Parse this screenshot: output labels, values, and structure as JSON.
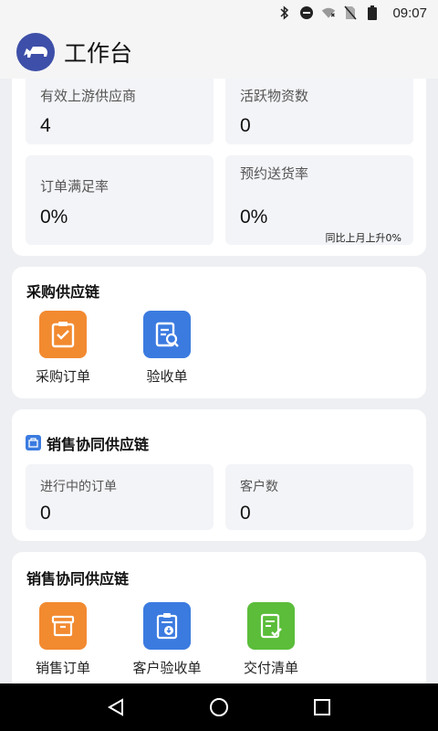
{
  "status_bar": {
    "time": "09:07",
    "icons": [
      "bluetooth-icon",
      "do-not-disturb-icon",
      "wifi-icon",
      "no-sim-icon",
      "battery-icon"
    ]
  },
  "app_bar": {
    "title": "工作台",
    "logo_icon": "rhino-logo-icon"
  },
  "summary": {
    "stats": [
      {
        "label": "有效上游供应商",
        "value": "4"
      },
      {
        "label": "活跃物资数",
        "value": "0"
      },
      {
        "label": "订单满足率",
        "value": "0%"
      },
      {
        "label": "预约送货率",
        "value": "0%"
      }
    ],
    "note": "同比上月上升0%"
  },
  "purchase_chain": {
    "title": "采购供应链",
    "items": [
      {
        "label": "采购订单",
        "icon": "clipboard-check-icon",
        "color": "#f28a30"
      },
      {
        "label": "验收单",
        "icon": "document-search-icon",
        "color": "#3b7be0"
      }
    ]
  },
  "sales_stats": {
    "title": "销售协同供应链",
    "icon": "sales-icon",
    "stats": [
      {
        "label": "进行中的订单",
        "value": "0"
      },
      {
        "label": "客户数",
        "value": "0"
      }
    ]
  },
  "sales_chain": {
    "title": "销售协同供应链",
    "items": [
      {
        "label": "销售订单",
        "icon": "archive-box-icon",
        "color": "#f28a30"
      },
      {
        "label": "客户验收单",
        "icon": "clipboard-download-icon",
        "color": "#3b7be0"
      },
      {
        "label": "交付清单",
        "icon": "document-check-icon",
        "color": "#5bbd3a"
      }
    ]
  },
  "nav_bar": {
    "icons": [
      "back-icon",
      "home-icon",
      "recents-icon"
    ]
  }
}
